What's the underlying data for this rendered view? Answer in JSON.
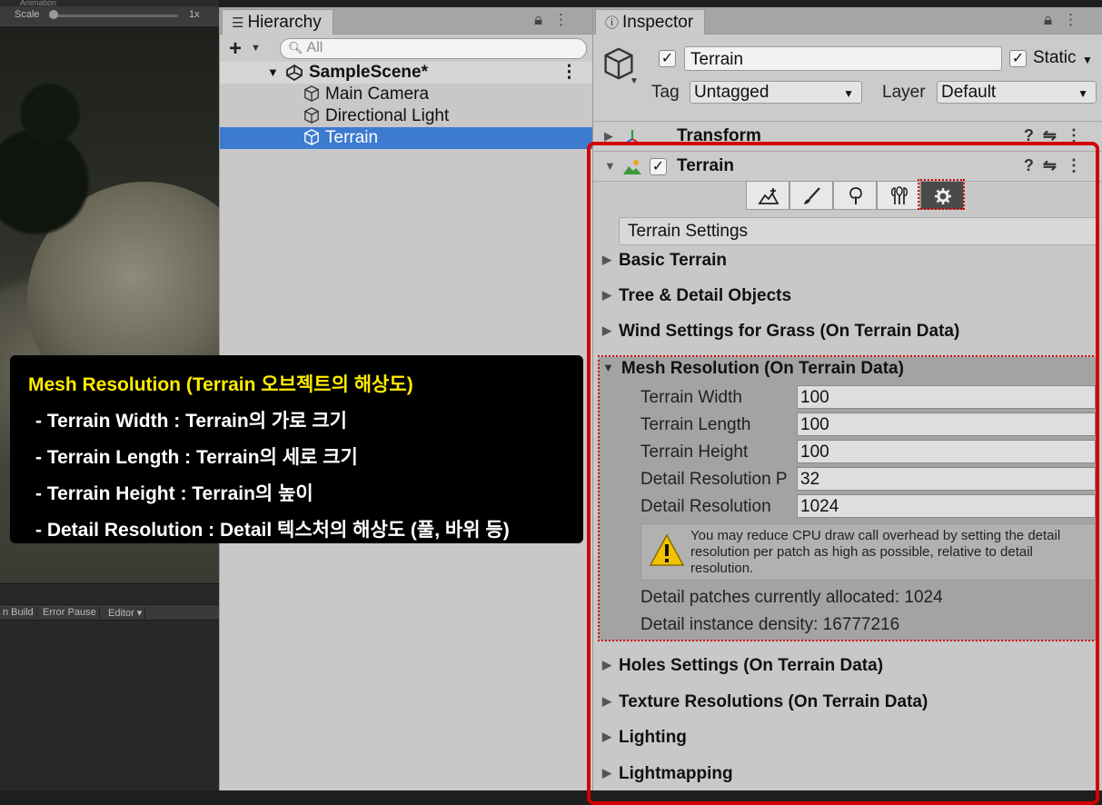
{
  "scene_view": {
    "top_strip": "Animation",
    "scale_label": "Scale",
    "scale_value": "1x",
    "scale_fraction": 0.02
  },
  "console": {
    "toolbar": [
      "n Build",
      "Error Pause",
      "Editor ▾"
    ]
  },
  "hierarchy": {
    "tab_label": "Hierarchy",
    "search_placeholder": "All",
    "scene_name": "SampleScene*",
    "items": [
      {
        "label": "Main Camera",
        "selected": false
      },
      {
        "label": "Directional Light",
        "selected": false
      },
      {
        "label": "Terrain",
        "selected": true
      }
    ]
  },
  "inspector": {
    "tab_label": "Inspector",
    "object_name": "Terrain",
    "active": true,
    "static_label": "Static",
    "static_checked": true,
    "tag_label": "Tag",
    "tag_value": "Untagged",
    "layer_label": "Layer",
    "layer_value": "Default",
    "components": {
      "transform": "Transform",
      "terrain": "Terrain"
    },
    "terrain_tools": [
      "create-neighbor",
      "paint",
      "place-trees",
      "paint-details",
      "settings"
    ],
    "terrain_settings_label": "Terrain Settings",
    "sections_top": [
      "Basic Terrain",
      "Tree & Detail Objects",
      "Wind Settings for Grass (On Terrain Data)"
    ],
    "mesh_resolution": {
      "title": "Mesh Resolution (On Terrain Data)",
      "fields": [
        {
          "label": "Terrain Width",
          "value": "100"
        },
        {
          "label": "Terrain Length",
          "value": "100"
        },
        {
          "label": "Terrain Height",
          "value": "100"
        },
        {
          "label": "Detail Resolution P",
          "value": "32"
        },
        {
          "label": "Detail Resolution",
          "value": "1024"
        }
      ],
      "warning": "You may reduce CPU draw call overhead by setting the detail resolution per patch as high as possible, relative to detail resolution.",
      "allocated": "Detail patches currently allocated: 1024",
      "density": "Detail instance density: 16777216"
    },
    "sections_bottom": [
      "Holes Settings (On Terrain Data)",
      "Texture Resolutions (On Terrain Data)",
      "Lighting",
      "Lightmapping"
    ]
  },
  "caption": {
    "title": "Mesh Resolution (Terrain 오브젝트의 해상도)",
    "lines": [
      "- Terrain Width : Terrain의 가로 크기",
      "- Terrain Length : Terrain의 세로 크기",
      "- Terrain Height : Terrain의 높이",
      "- Detail Resolution : Detail 텍스처의 해상도 (풀, 바위 등)"
    ]
  },
  "colors": {
    "selection": "#3d7bd1",
    "highlight": "#d40000",
    "caption_title": "#ffeb00"
  }
}
